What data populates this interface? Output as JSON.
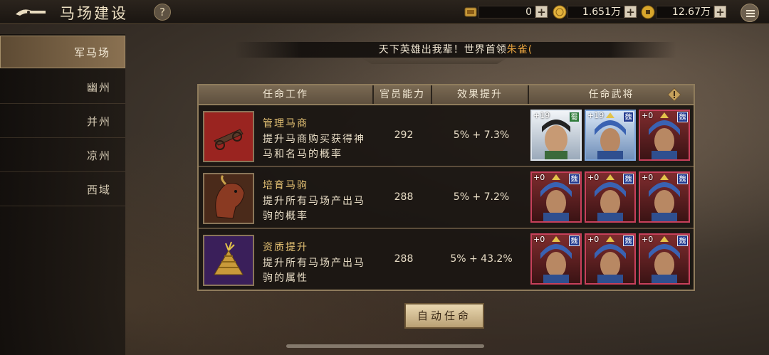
{
  "header": {
    "title": "马场建设",
    "help_label": "?",
    "resources": [
      {
        "icon": "scroll-token-icon",
        "value": "0"
      },
      {
        "icon": "gold-coin-icon",
        "value": "1.651万"
      },
      {
        "icon": "copper-coin-icon",
        "value": "12.67万"
      }
    ],
    "plus_label": "+"
  },
  "sidebar": {
    "items": [
      {
        "label": "军马场",
        "active": true
      },
      {
        "label": "幽州",
        "active": false
      },
      {
        "label": "并州",
        "active": false
      },
      {
        "label": "凉州",
        "active": false
      },
      {
        "label": "西域",
        "active": false
      }
    ]
  },
  "banner": {
    "text": "天下英雄出我辈！世界首领",
    "highlight": "朱雀("
  },
  "table": {
    "headers": [
      "任命工作",
      "官员能力",
      "效果提升",
      "任命武将"
    ],
    "rows": [
      {
        "title": "管理马商",
        "desc": "提升马商购买获得神马和名马的概率",
        "ability": "292",
        "effect": "5% + 7.3%",
        "icon": "horse-cart-icon",
        "generals": [
          {
            "level": "+19",
            "faction": "蜀",
            "style": "white"
          },
          {
            "level": "+19",
            "faction": "魏",
            "style": "blue"
          },
          {
            "level": "+0",
            "faction": "魏",
            "style": "red"
          }
        ]
      },
      {
        "title": "培育马驹",
        "desc": "提升所有马场产出马驹的概率",
        "ability": "288",
        "effect": "5% + 7.2%",
        "icon": "warhorse-head-icon",
        "generals": [
          {
            "level": "+0",
            "faction": "魏",
            "style": "red"
          },
          {
            "level": "+0",
            "faction": "魏",
            "style": "red"
          },
          {
            "level": "+0",
            "faction": "魏",
            "style": "red"
          }
        ]
      },
      {
        "title": "资质提升",
        "desc": "提升所有马场产出马驹的属性",
        "ability": "288",
        "effect": "5% + 43.2%",
        "icon": "hay-bundle-icon",
        "generals": [
          {
            "level": "+0",
            "faction": "魏",
            "style": "red"
          },
          {
            "level": "+0",
            "faction": "魏",
            "style": "red"
          },
          {
            "level": "+0",
            "faction": "魏",
            "style": "red"
          }
        ]
      }
    ]
  },
  "auto_button": "自动任命",
  "colors": {
    "accent": "#e6a23e",
    "gold_text": "#e6c375",
    "frame": "#8f7c5c"
  }
}
